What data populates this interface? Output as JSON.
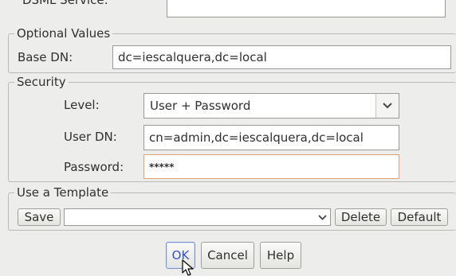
{
  "dsml": {
    "label": "DSML Service:",
    "value": ""
  },
  "optional_values": {
    "legend": "Optional Values",
    "base_dn_label": "Base DN:",
    "base_dn_value": "dc=iescalquera,dc=local"
  },
  "security": {
    "legend": "Security",
    "level_label": "Level:",
    "level_value": "User + Password",
    "user_dn_label": "User DN:",
    "user_dn_value": "cn=admin,dc=iescalquera,dc=local",
    "password_label": "Password:",
    "password_value": "*****"
  },
  "template": {
    "legend": "Use a Template",
    "save_label": "Save",
    "selected_value": "",
    "delete_label": "Delete",
    "default_label": "Default"
  },
  "dialog_buttons": {
    "ok_label": "OK",
    "cancel_label": "Cancel",
    "help_label": "Help"
  },
  "icons": {
    "dropdown": "chevron-down-icon",
    "cursor": "mouse-pointer-icon"
  }
}
